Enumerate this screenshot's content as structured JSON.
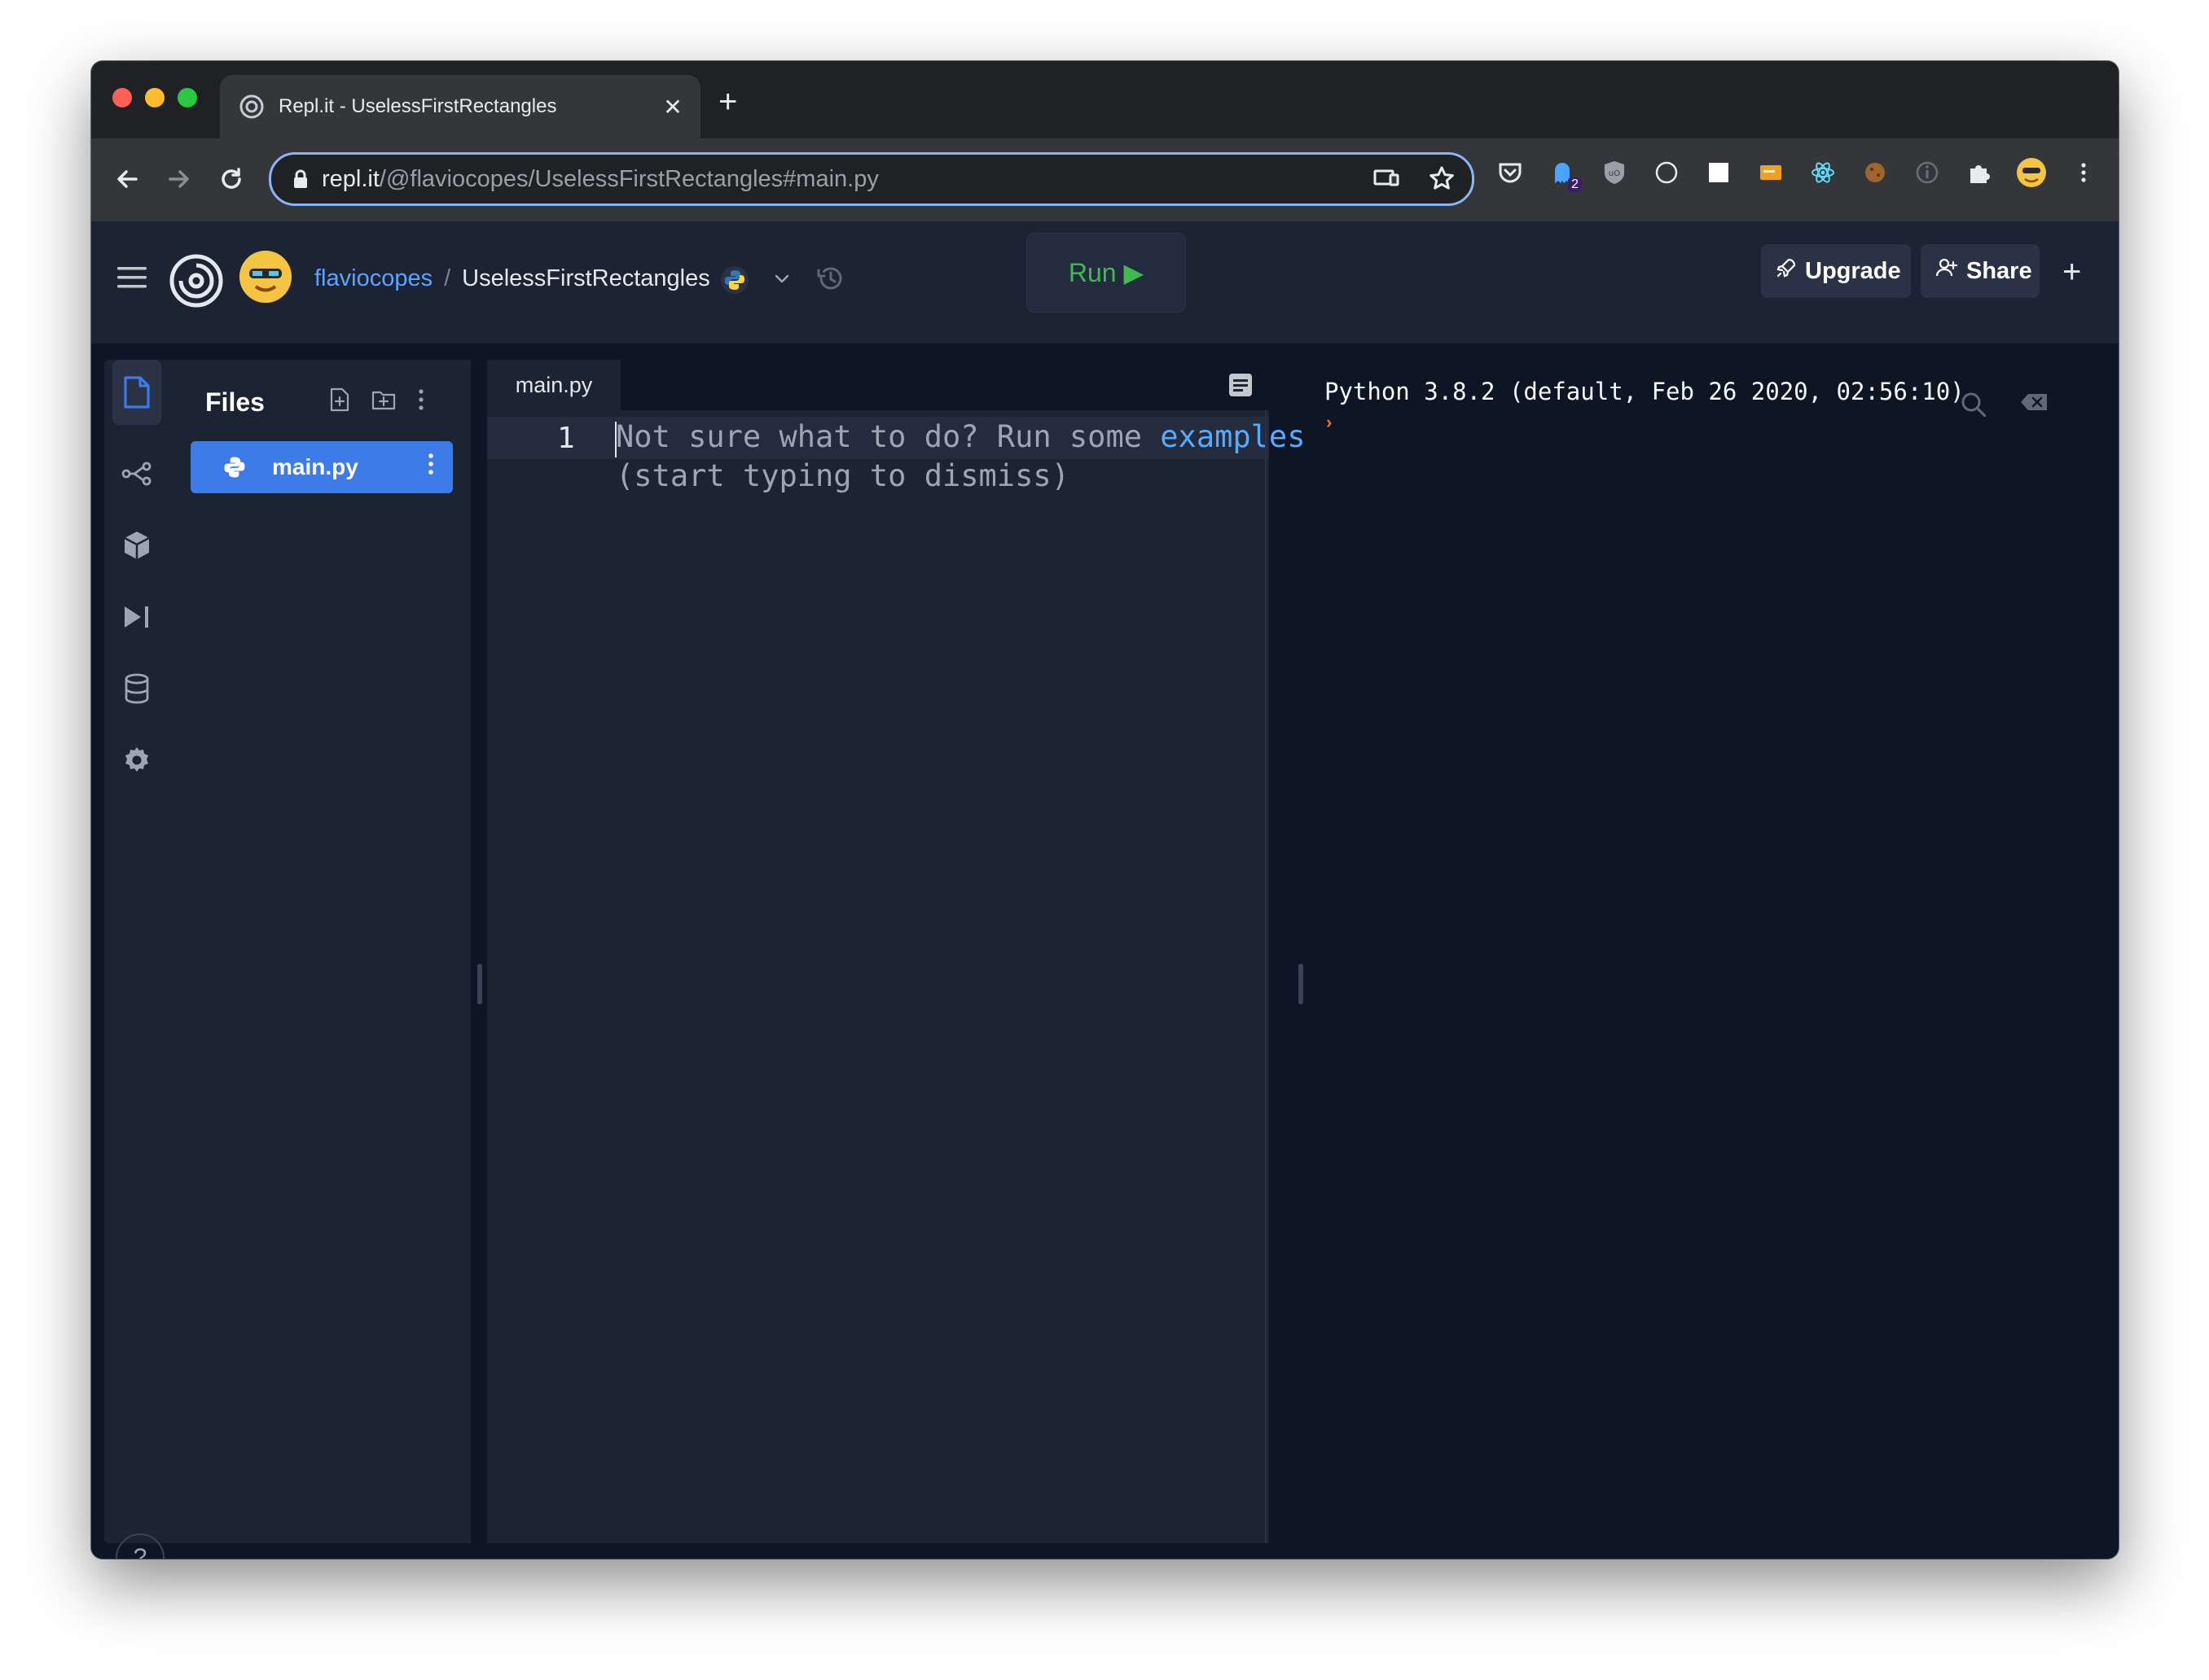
{
  "browser": {
    "tab_title": "Repl.it - UselessFirstRectangles",
    "tab_close": "✕",
    "new_tab": "+",
    "url_host": "repl.it",
    "url_path": "/@flaviocopes/UselessFirstRectangles#main.py",
    "extension_badge": "2"
  },
  "header": {
    "user": "flaviocopes",
    "separator": "/",
    "project": "UselessFirstRectangles",
    "run_label": "Run ▶",
    "upgrade_label": "Upgrade",
    "share_label": "Share",
    "plus": "+"
  },
  "files": {
    "title": "Files",
    "items": [
      {
        "name": "main.py"
      }
    ]
  },
  "editor": {
    "tab_label": "main.py",
    "line_number": "1",
    "placeholder_text": "Not sure what to do? Run some ",
    "placeholder_link": "examples",
    "placeholder_line2": "(start typing to dismiss)"
  },
  "console": {
    "banner": "Python 3.8.2 (default, Feb 26 2020, 02:56:10)",
    "prompt": "›"
  },
  "help": {
    "label": "?"
  },
  "colors": {
    "accent_blue": "#3d7be8",
    "run_green": "#3fb950",
    "user_link": "#5da4ff",
    "prompt_orange": "#ff6a2b"
  }
}
